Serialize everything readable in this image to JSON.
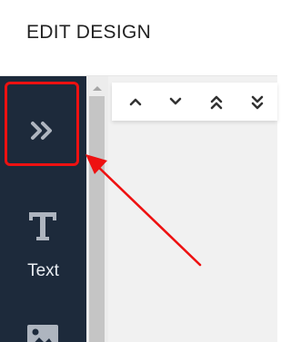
{
  "header": {
    "title": "EDIT DESIGN"
  },
  "sidebar": {
    "collapse_button": {
      "icon": "double-chevron-right-icon"
    },
    "items": [
      {
        "label": "Text",
        "icon": "text-t-icon"
      },
      {
        "label": "",
        "icon": "image-icon"
      }
    ]
  },
  "toolbar": {
    "buttons": [
      {
        "icon": "chevron-up-icon"
      },
      {
        "icon": "chevron-down-icon"
      },
      {
        "icon": "double-chevron-up-icon"
      },
      {
        "icon": "double-chevron-down-icon"
      }
    ]
  },
  "annotation": {
    "highlight_color": "#ee1111"
  },
  "colors": {
    "sidebar_bg": "#1d2a3b",
    "sidebar_icon": "#aeb5bf",
    "canvas_bg": "#f1f1f1"
  }
}
